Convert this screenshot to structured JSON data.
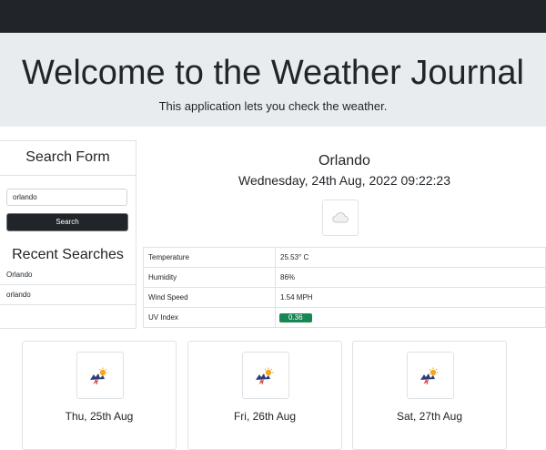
{
  "hero": {
    "title": "Welcome to the Weather Journal",
    "subtitle": "This application lets you check the weather."
  },
  "search_form": {
    "title": "Search Form",
    "input_value": "orlando",
    "button_label": "Search"
  },
  "recent": {
    "title": "Recent Searches",
    "items": [
      "Orlando",
      "orlando"
    ]
  },
  "current": {
    "city": "Orlando",
    "datetime": "Wednesday, 24th Aug, 2022 09:22:23",
    "icon": "cloud-icon",
    "metrics": [
      {
        "label": "Temperature",
        "value": "25.53° C"
      },
      {
        "label": "Humidity",
        "value": "86%"
      },
      {
        "label": "Wind Speed",
        "value": "1.54 MPH"
      },
      {
        "label": "UV Index",
        "value": "0.36"
      }
    ],
    "uv_color": "#198754"
  },
  "forecast": [
    {
      "date": "Thu, 25th Aug",
      "icon": "thunderstorm-icon"
    },
    {
      "date": "Fri, 26th Aug",
      "icon": "thunderstorm-icon"
    },
    {
      "date": "Sat, 27th Aug",
      "icon": "thunderstorm-icon"
    }
  ]
}
